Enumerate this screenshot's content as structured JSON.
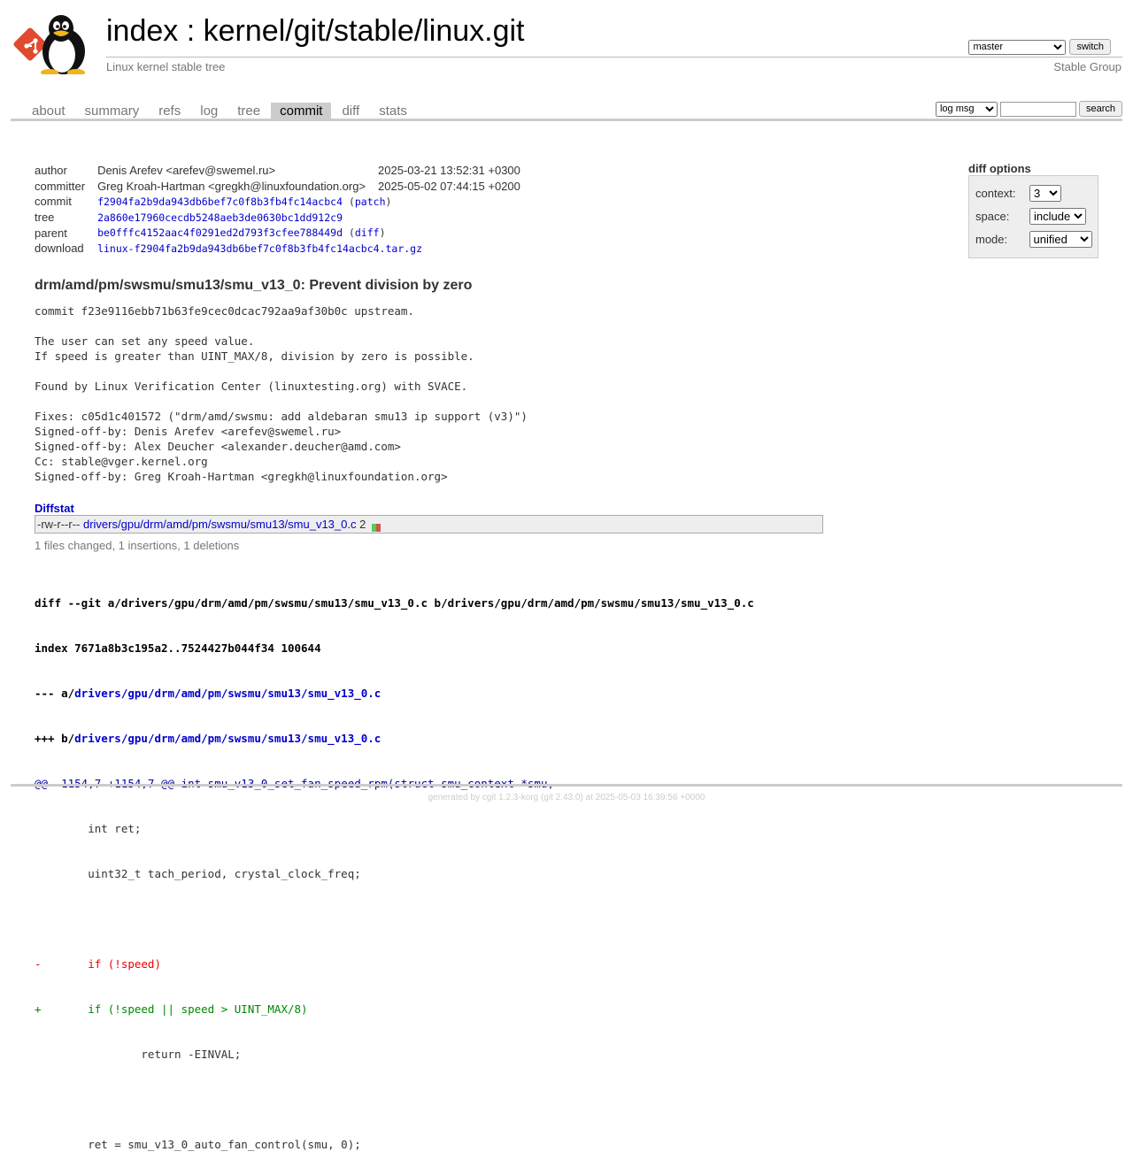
{
  "header": {
    "title_index": "index",
    "title_sep": ":",
    "title_repo": "kernel/git/stable/linux.git",
    "subtitle": "Linux kernel stable tree",
    "owner": "Stable Group",
    "branch": "master",
    "switch_label": "switch"
  },
  "tabs": [
    {
      "label": "about"
    },
    {
      "label": "summary"
    },
    {
      "label": "refs"
    },
    {
      "label": "log"
    },
    {
      "label": "tree"
    },
    {
      "label": "commit",
      "active": true
    },
    {
      "label": "diff"
    },
    {
      "label": "stats"
    }
  ],
  "search": {
    "scope": "log msg",
    "value": "",
    "button": "search"
  },
  "commit_info": {
    "author_label": "author",
    "author": "Denis Arefev <arefev@swemel.ru>",
    "author_date": "2025-03-21 13:52:31 +0300",
    "committer_label": "committer",
    "committer": "Greg Kroah-Hartman <gregkh@linuxfoundation.org>",
    "committer_date": "2025-05-02 07:44:15 +0200",
    "commit_label": "commit",
    "commit": "f2904fa2b9da943db6bef7c0f8b3fb4fc14acbc4",
    "patch_link": "patch",
    "tree_label": "tree",
    "tree": "2a860e17960cecdb5248aeb3de0630bc1dd912c9",
    "parent_label": "parent",
    "parent": "be0fffc4152aac4f0291ed2d793f3cfee788449d",
    "diff_link": "diff",
    "download_label": "download",
    "download": "linux-f2904fa2b9da943db6bef7c0f8b3fb4fc14acbc4.tar.gz"
  },
  "diff_options": {
    "title": "diff options",
    "context_label": "context:",
    "context": "3",
    "space_label": "space:",
    "space": "include",
    "mode_label": "mode:",
    "mode": "unified"
  },
  "message": {
    "subject": "drm/amd/pm/swsmu/smu13/smu_v13_0: Prevent division by zero",
    "body": "commit f23e9116ebb71b63fe9cec0dcac792aa9af30b0c upstream.\n\nThe user can set any speed value.\nIf speed is greater than UINT_MAX/8, division by zero is possible.\n\nFound by Linux Verification Center (linuxtesting.org) with SVACE.\n\nFixes: c05d1c401572 (\"drm/amd/swsmu: add aldebaran smu13 ip support (v3)\")\nSigned-off-by: Denis Arefev <arefev@swemel.ru>\nSigned-off-by: Alex Deucher <alexander.deucher@amd.com>\nCc: stable@vger.kernel.org\nSigned-off-by: Greg Kroah-Hartman <gregkh@linuxfoundation.org>"
  },
  "diffstat": {
    "title": "Diffstat",
    "mode": "-rw-r--r--",
    "file": "drivers/gpu/drm/amd/pm/swsmu/smu13/smu_v13_0.c",
    "changes": "2",
    "insertions": 1,
    "deletions": 1,
    "summary": "1 files changed, 1 insertions, 1 deletions"
  },
  "diff": {
    "git_prefix": "diff --git a/drivers/gpu/drm/amd/pm/swsmu/smu13/smu_v13_0.c b/drivers/gpu/drm/amd/pm/swsmu/smu13/smu_v13_0.c",
    "index": "index 7671a8b3c195a2..7524427b044f34 100644",
    "minus_prefix": "--- a/",
    "plus_prefix": "+++ b/",
    "path": "drivers/gpu/drm/amd/pm/swsmu/smu13/smu_v13_0.c",
    "hunk": "@@ -1154,7 +1154,7 @@",
    "hunk_fn": " int smu_v13_0_set_fan_speed_rpm(struct smu_context *smu,",
    "lines": [
      {
        "type": "ctx",
        "text": "        int ret;"
      },
      {
        "type": "ctx",
        "text": "        uint32_t tach_period, crystal_clock_freq;"
      },
      {
        "type": "ctx",
        "text": ""
      },
      {
        "type": "del",
        "text": "-       if (!speed)"
      },
      {
        "type": "add",
        "text": "+       if (!speed || speed > UINT_MAX/8)"
      },
      {
        "type": "ctx",
        "text": "                return -EINVAL;"
      },
      {
        "type": "ctx",
        "text": ""
      },
      {
        "type": "ctx",
        "text": "        ret = smu_v13_0_auto_fan_control(smu, 0);"
      }
    ]
  },
  "footer": {
    "prefix": "generated by",
    "cgit": "cgit 1.2.3-korg",
    "git": "(git 2.43.0)",
    "suffix": "at 2025-05-03 16:39:56 +0000"
  },
  "colors": {
    "link": "#0000cc",
    "added": "#008800",
    "removed": "#ee0000",
    "tab_active_bg": "#cccccc"
  }
}
